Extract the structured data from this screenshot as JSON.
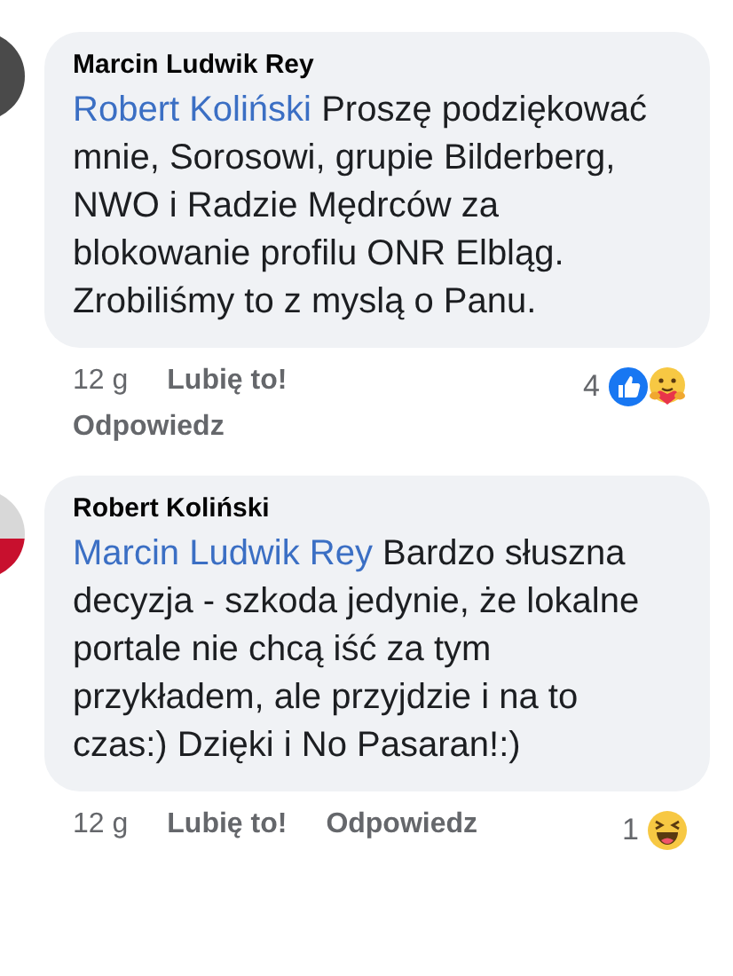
{
  "comments": [
    {
      "author": "Marcin Ludwik Rey",
      "mention": "Robert Koliński",
      "text": "Proszę podziękować mnie, Sorosowi, grupie Bilderberg, NWO i Radzie Mędrców za blokowanie profilu ONR Elbląg. Zrobiliśmy to z myslą o Panu.",
      "time": "12 g",
      "like": "Lubię to!",
      "reply": "Odpowiedz",
      "reply_on_new_line": true,
      "reaction_count": "4",
      "reactions": [
        {
          "kind": "like"
        },
        {
          "kind": "care"
        }
      ]
    },
    {
      "author": "Robert Koliński",
      "mention": "Marcin Ludwik Rey",
      "text": "Bardzo słuszna decyzja - szkoda jedynie, że lokalne portale nie chcą iść za tym przykładem, ale przyjdzie i na to czas:) Dzięki i No Pasaran!:)",
      "time": "12 g",
      "like": "Lubię to!",
      "reply": "Odpowiedz",
      "reply_on_new_line": false,
      "reaction_count": "1",
      "reactions": [
        {
          "kind": "haha"
        }
      ]
    }
  ]
}
